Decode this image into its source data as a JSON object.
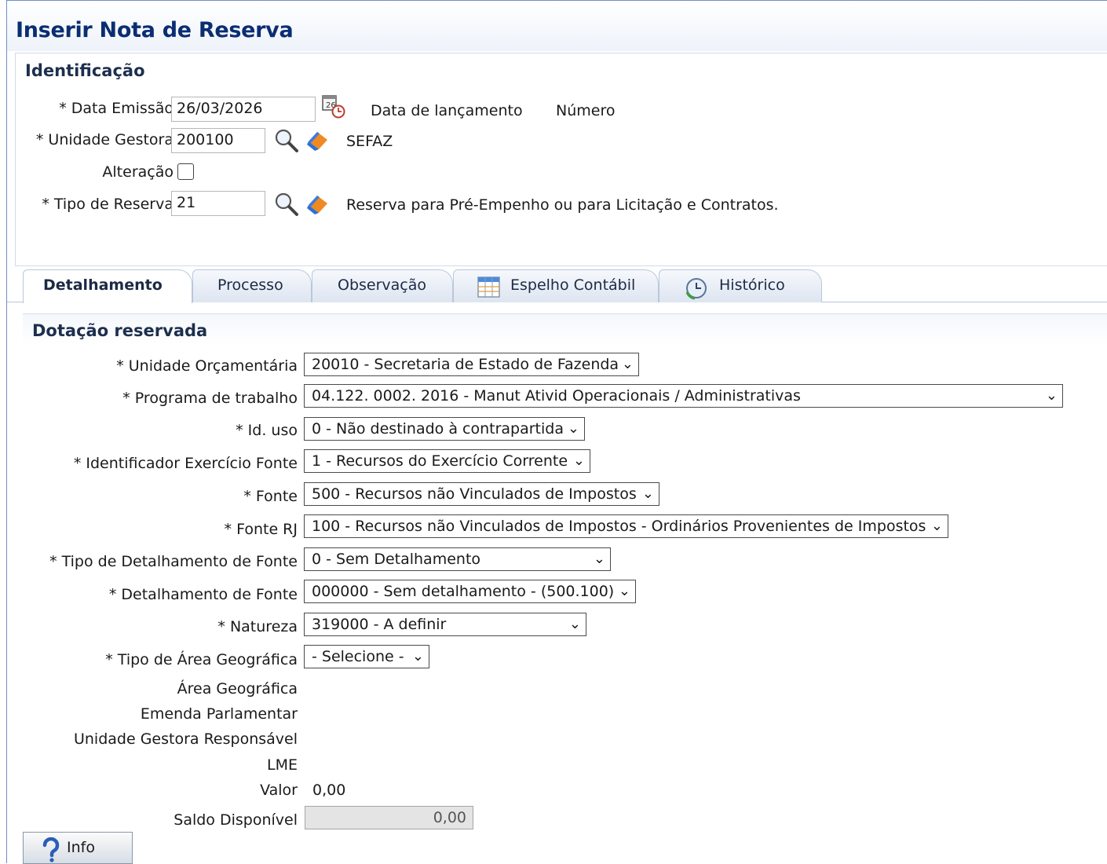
{
  "page": {
    "title": "Inserir Nota de Reserva"
  },
  "identificacao": {
    "title": "Identificação",
    "data_emissao_label": "* Data Emissão",
    "data_emissao_value": "26/03/2026",
    "data_lancamento_label": "Data de lançamento",
    "numero_label": "Número",
    "unidade_gestora_label": "* Unidade Gestora",
    "unidade_gestora_value": "200100",
    "unidade_gestora_desc": "SEFAZ",
    "alteracao_label": "Alteração",
    "alteracao_checked": false,
    "tipo_reserva_label": "* Tipo de Reserva",
    "tipo_reserva_value": "21",
    "tipo_reserva_desc": "Reserva para Pré-Empenho ou para Licitação e Contratos."
  },
  "tabs": [
    {
      "label": "Detalhamento",
      "active": true,
      "icon": ""
    },
    {
      "label": "Processo",
      "active": false,
      "icon": ""
    },
    {
      "label": "Observação",
      "active": false,
      "icon": ""
    },
    {
      "label": "Espelho Contábil",
      "active": false,
      "icon": "spreadsheet-icon"
    },
    {
      "label": "Histórico",
      "active": false,
      "icon": "clock-history-icon"
    }
  ],
  "dotacao": {
    "title": "Dotação reservada",
    "fields": [
      {
        "label": "* Unidade Orçamentária",
        "value": "20010 - Secretaria de Estado de Fazenda"
      },
      {
        "label": "* Programa de trabalho",
        "value": "04.122. 0002. 2016 - Manut Ativid Operacionais / Administrativas"
      },
      {
        "label": "* Id. uso",
        "value": "0 - Não destinado à contrapartida"
      },
      {
        "label": "* Identificador Exercício Fonte",
        "value": "1 - Recursos do Exercício Corrente"
      },
      {
        "label": "* Fonte",
        "value": "500 - Recursos não Vinculados de Impostos"
      },
      {
        "label": "* Fonte RJ",
        "value": "100 - Recursos não Vinculados de Impostos - Ordinários Provenientes de Impostos"
      },
      {
        "label": "* Tipo de Detalhamento de Fonte",
        "value": "0 - Sem Detalhamento"
      },
      {
        "label": "* Detalhamento de Fonte",
        "value": "000000 - Sem detalhamento - (500.100)"
      },
      {
        "label": "* Natureza",
        "value": "319000 - A definir"
      },
      {
        "label": "* Tipo de Área Geográfica",
        "value": "- Selecione -"
      }
    ],
    "area_geografica_label": "Área Geográfica",
    "emenda_label": "Emenda Parlamentar",
    "ug_responsavel_label": "Unidade Gestora Responsável",
    "lme_label": "LME",
    "valor_label": "Valor",
    "valor_value": "0,00",
    "saldo_label": "Saldo Disponível",
    "saldo_value": "0,00"
  },
  "footer": {
    "info_label": "Info"
  },
  "colors": {
    "title": "#0b2d72",
    "border": "#6f8fc2",
    "tab_bg": "#dde5f1"
  }
}
